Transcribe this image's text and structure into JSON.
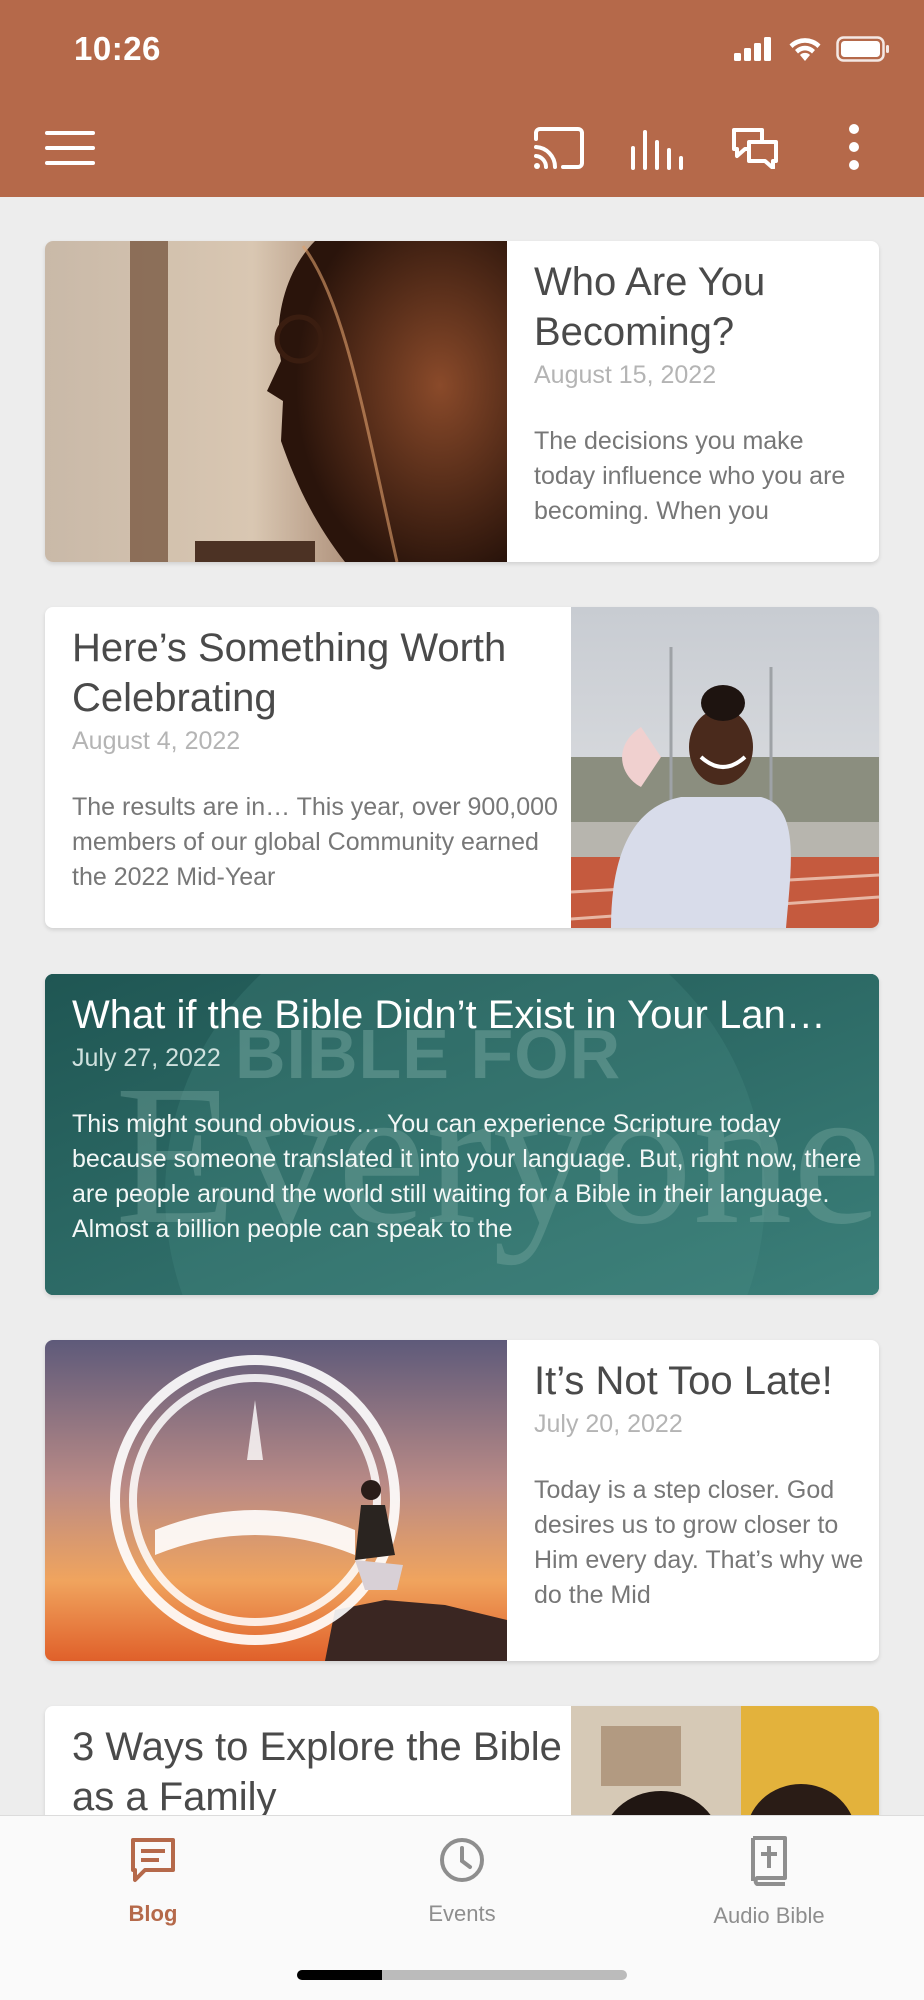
{
  "status_bar": {
    "time": "10:26"
  },
  "toolbar": {
    "icons": [
      "menu-icon",
      "cast-icon",
      "equalizer-icon",
      "chat-icon",
      "more-vertical-icon"
    ]
  },
  "posts": [
    {
      "title": "Who Are You Becoming?",
      "date": "August 15, 2022",
      "excerpt": "The decisions you make today influence who you are becoming. When you"
    },
    {
      "title": "Here’s Something Worth Celebrating",
      "date": "August 4, 2022",
      "excerpt": "The results are in… This year, over 900,000 members of our global Community earned the 2022 Mid-Year"
    },
    {
      "title": "What if the Bible Didn’t Exist in Your Lan…",
      "date": "July 27, 2022",
      "excerpt": "This might sound obvious… You can experience Scripture today because someone translated it into your language. But, right now, there are people around the world still waiting for a Bible in their language. Almost a billion people can speak to the",
      "background_text_1": "BIBLE FOR",
      "background_text_2": "Everyone"
    },
    {
      "title": "It’s Not Too Late!",
      "date": "July 20, 2022",
      "excerpt": "Today is a step closer. God desires us to grow closer to Him every day. That’s why we do the Mid"
    },
    {
      "title": "3 Ways to Explore the Bible as a Family"
    }
  ],
  "bottom_nav": {
    "items": [
      {
        "label": "Blog",
        "icon": "blog-icon",
        "active": true
      },
      {
        "label": "Events",
        "icon": "clock-icon",
        "active": false
      },
      {
        "label": "Audio Bible",
        "icon": "audio-bible-icon",
        "active": false
      }
    ]
  },
  "colors": {
    "brand": "#b5694a",
    "background": "#ededed",
    "teal_card": "#2f6f6b"
  }
}
